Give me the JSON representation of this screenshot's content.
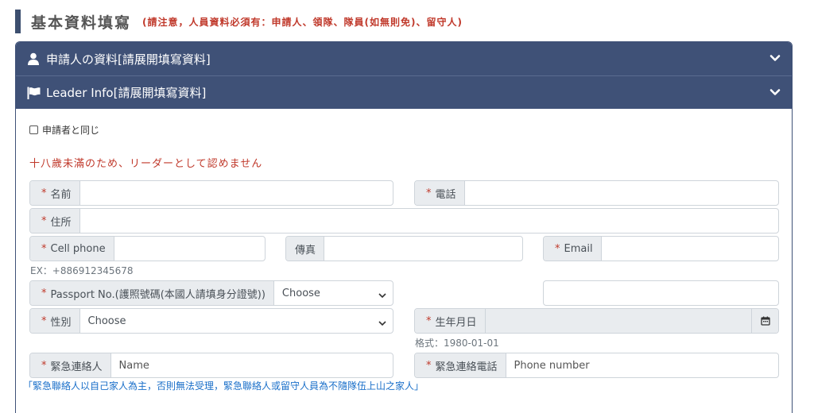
{
  "section": {
    "title": "基本資料填寫",
    "note": "(請注意，人員資料必須有：申請人、領隊、隊員(如無則免)、留守人)"
  },
  "panels": {
    "applicant_header": "申請人の資料[請展開填寫資料]",
    "leader_header": "Leader Info[請展開填寫資料]"
  },
  "form": {
    "same_as_applicant": "申請者と同じ",
    "warning": "十八歲未滿のため、リーダーとして認めません",
    "required_mark": "*",
    "name_label": "名前",
    "phone_label": "電話",
    "address_label": "住所",
    "cell_label": "Cell phone",
    "fax_label": "傳真",
    "email_label": "Email",
    "cell_example": "EX：+886912345678",
    "passport_label": "Passport No.(護照號碼(本國人請填身分證號))",
    "passport_select": "Choose",
    "gender_label": "性別",
    "gender_select": "Choose",
    "birthday_label": "生年月日",
    "birthday_format": "格式：1980-01-01",
    "emergency_contact_label": "緊急連絡人",
    "emergency_contact_placeholder": "Name",
    "emergency_phone_label": "緊急連絡電話",
    "emergency_phone_placeholder": "Phone number",
    "emergency_note": "「緊急聯絡人以自己家人為主，否則無法受理，緊急聯絡人或留守人員為不隨隊伍上山之家人」"
  },
  "colors": {
    "header_bg": "#3f5177",
    "required": "#c0392b",
    "note_blue": "#1a6fc9"
  }
}
